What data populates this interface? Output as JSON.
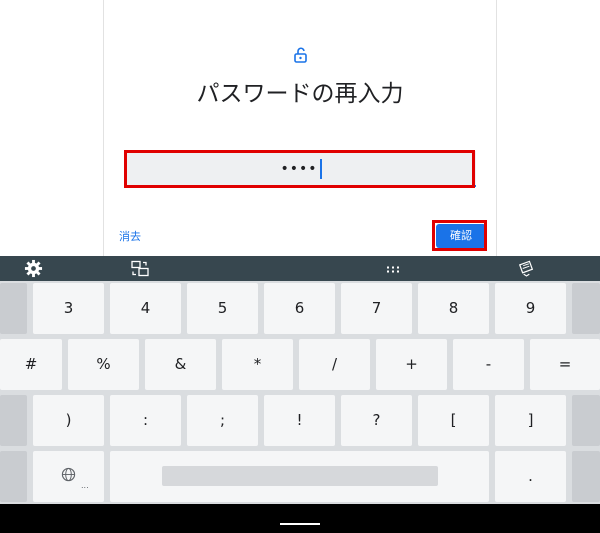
{
  "dialog": {
    "title": "パスワードの再入力",
    "password_mask": "••••",
    "clear_label": "消去",
    "confirm_label": "確認"
  },
  "icons": [
    "lock-open-icon",
    "settings-icon",
    "keyboard-switch-icon",
    "grid-icon",
    "keyboard-hide-icon",
    "globe-icon"
  ],
  "keyboard": {
    "row1": [
      "3",
      "4",
      "5",
      "6",
      "7",
      "8",
      "9"
    ],
    "row2": [
      "#",
      "%",
      "&",
      "*",
      "/",
      "+",
      "-",
      "="
    ],
    "row3": [
      ")",
      ":",
      ";",
      "!",
      "?",
      "[",
      "]"
    ],
    "row4_globe_sub": "...",
    "row4_period": "."
  },
  "colors": {
    "accent": "#1a73e8",
    "highlight": "#e00000",
    "toolbar": "#37474f"
  }
}
